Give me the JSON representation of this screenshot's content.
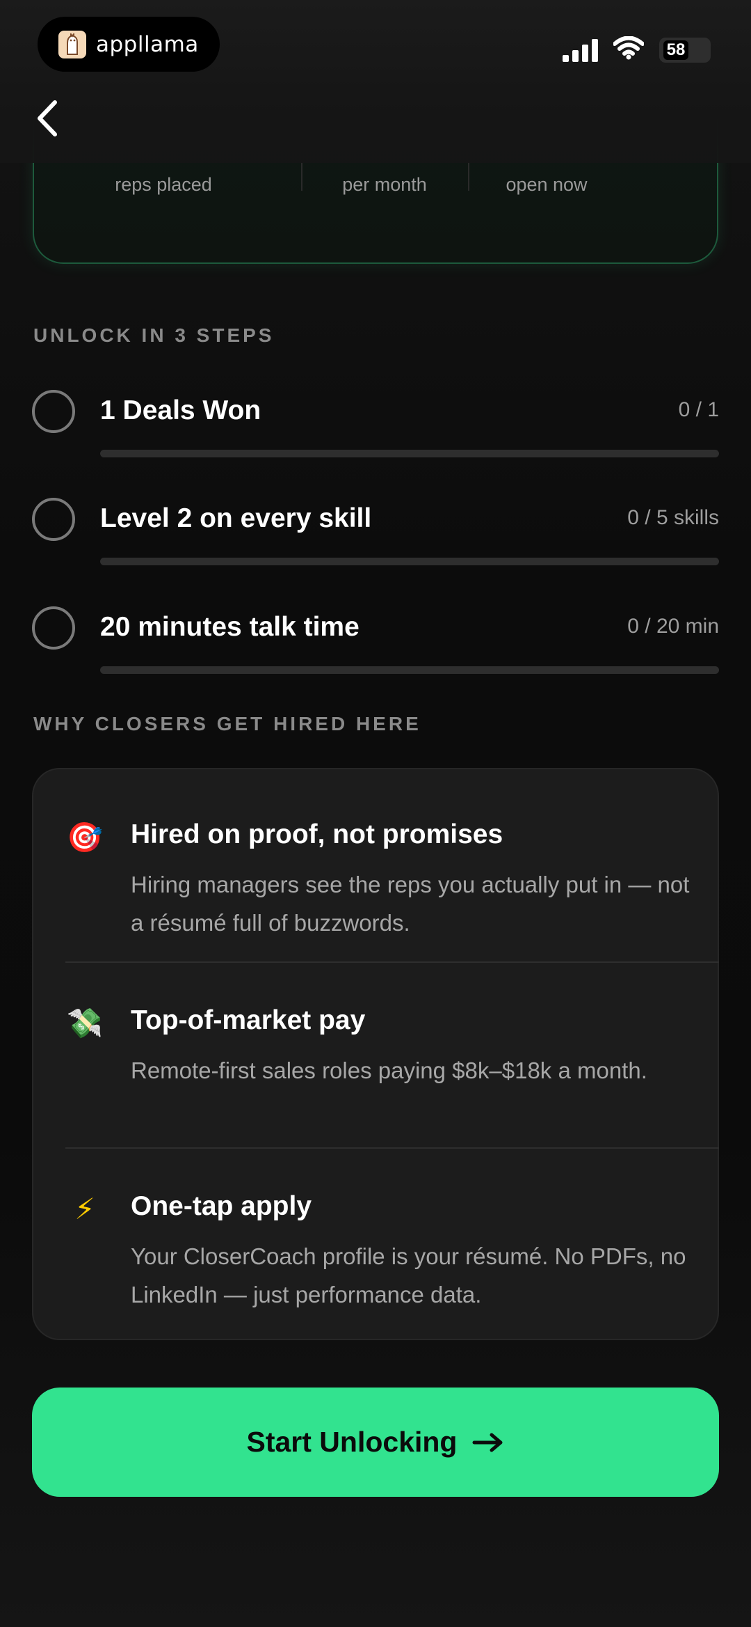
{
  "status_bar": {
    "brand_name": "appllama",
    "brand_logo": "llama-logo-icon",
    "battery_text": "58"
  },
  "nav": {
    "back_icon": "chevron-left-icon"
  },
  "stats": {
    "labels": [
      "reps placed",
      "per month",
      "open now"
    ]
  },
  "unlock": {
    "header": "UNLOCK IN 3 STEPS",
    "steps": [
      {
        "title": "1 Deals Won",
        "progress_text": "0 / 1",
        "progress": 0
      },
      {
        "title": "Level 2 on every skill",
        "progress_text": "0 / 5 skills",
        "progress": 0
      },
      {
        "title": "20 minutes talk time",
        "progress_text": "0 / 20 min",
        "progress": 0
      }
    ]
  },
  "why": {
    "header": "WHY CLOSERS GET HIRED HERE",
    "benefits": [
      {
        "icon": "target-icon",
        "glyph": "🎯",
        "title": "Hired on proof, not promises",
        "desc": "Hiring managers see the reps you actually put in — not a résumé full of buzzwords."
      },
      {
        "icon": "money-wings-icon",
        "glyph": "💸",
        "title": "Top-of-market pay",
        "desc": "Remote-first sales roles paying $8k–$18k a month."
      },
      {
        "icon": "lightning-icon",
        "glyph": "⚡",
        "title": "One-tap apply",
        "desc": "Your CloserCoach profile is your résumé. No PDFs, no LinkedIn — just performance data."
      }
    ]
  },
  "cta": {
    "label": "Start Unlocking",
    "icon": "arrow-right-icon"
  },
  "colors": {
    "accent": "#32e38f",
    "card_border": "#1d5a3c"
  }
}
